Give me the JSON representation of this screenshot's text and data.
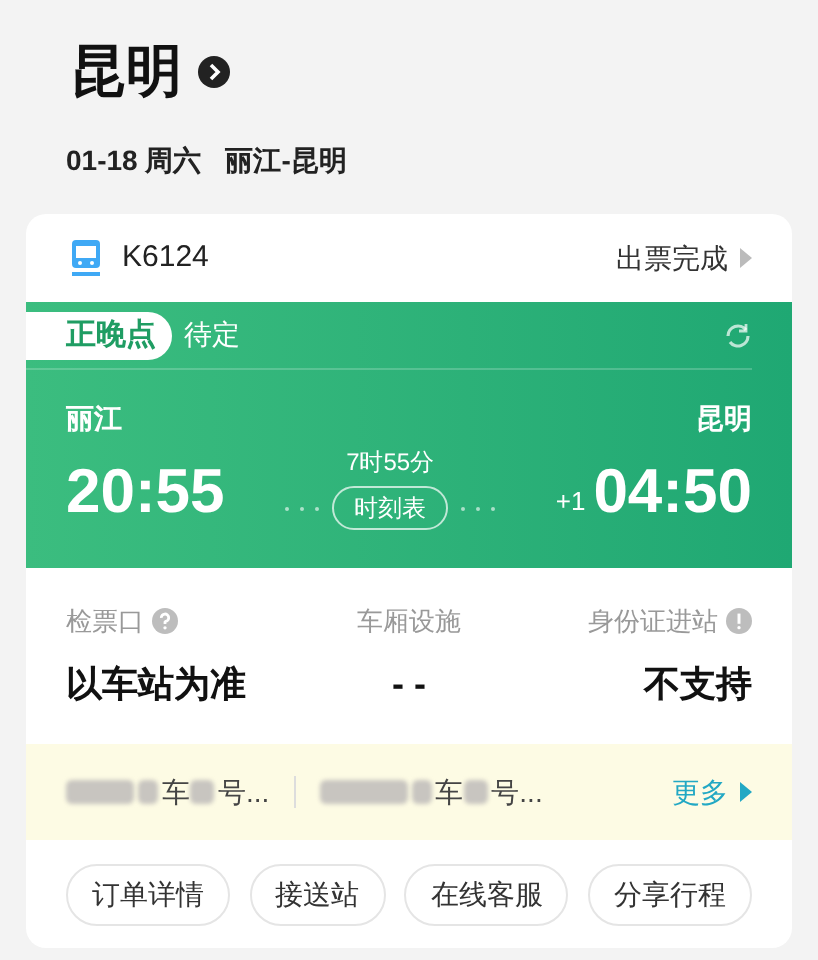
{
  "header": {
    "title": "昆明"
  },
  "trip": {
    "date": "01-18 周六",
    "route": "丽江-昆明"
  },
  "train": {
    "number": "K6124",
    "status": "出票完成"
  },
  "punctuality": {
    "label": "正晚点",
    "value": "待定"
  },
  "departure": {
    "station": "丽江",
    "time": "20:55"
  },
  "arrival": {
    "station": "昆明",
    "time": "04:50",
    "day_offset": "+1"
  },
  "duration": "7时55分",
  "timetable_button": "时刻表",
  "info": [
    {
      "label": "检票口",
      "value": "以车站为准",
      "kind": "help"
    },
    {
      "label": "车厢设施",
      "value": "- -",
      "kind": "plain"
    },
    {
      "label": "身份证进站",
      "value": "不支持",
      "kind": "notice"
    }
  ],
  "seats": [
    {
      "car": "车",
      "seat": "号..."
    },
    {
      "car": "车",
      "seat": "号..."
    }
  ],
  "more_link": "更多",
  "actions": [
    "订单详情",
    "接送站",
    "在线客服",
    "分享行程"
  ]
}
